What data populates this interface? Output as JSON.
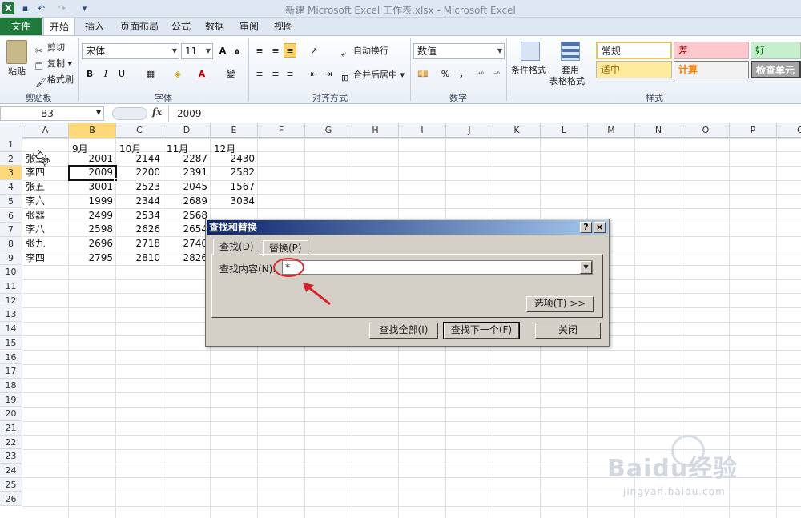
{
  "window": {
    "title": "新建 Microsoft Excel 工作表.xlsx - Microsoft Excel"
  },
  "tabs": [
    "文件",
    "开始",
    "插入",
    "页面布局",
    "公式",
    "数据",
    "审阅",
    "视图"
  ],
  "clipboard": {
    "paste": "粘贴",
    "cut": "剪切",
    "copy": "复制",
    "format_painter": "格式刷",
    "label": "剪贴板"
  },
  "font": {
    "name": "宋体",
    "size": "11",
    "bold": "B",
    "italic": "I",
    "underline": "U",
    "label": "字体",
    "grow": "A",
    "shrink": "A"
  },
  "alignment": {
    "wrap": "自动换行",
    "merge": "合并后居中",
    "label": "对齐方式"
  },
  "number": {
    "format": "数值",
    "percent": "%",
    "comma": ",",
    "label": "数字"
  },
  "styles_group": {
    "conditional": "条件格式",
    "table1": "套用",
    "table2": "表格格式",
    "label": "样式",
    "cells": [
      "常规",
      "差",
      "好",
      "适中",
      "计算",
      "检查单元格"
    ]
  },
  "formula_bar": {
    "name_box": "B3",
    "fx": "fx",
    "value": "2009"
  },
  "columns": [
    "A",
    "B",
    "C",
    "D",
    "E",
    "F",
    "G",
    "H",
    "I",
    "J",
    "K",
    "L",
    "M",
    "N",
    "O",
    "P",
    "Q"
  ],
  "rows": [
    "1",
    "2",
    "3",
    "4",
    "5",
    "6",
    "7",
    "8",
    "9",
    "10",
    "11",
    "12",
    "13",
    "14",
    "15",
    "16",
    "17",
    "18",
    "19",
    "20",
    "21",
    "22",
    "23",
    "24",
    "25",
    "26"
  ],
  "sheet": {
    "a1_rotated": "工资",
    "months": [
      "9月",
      "10月",
      "11月",
      "12月"
    ],
    "names": [
      "张三",
      "李四",
      "张五",
      "李六",
      "张器",
      "李八",
      "张九",
      "李四"
    ],
    "values": [
      [
        "2001",
        "2144",
        "2287",
        "2430"
      ],
      [
        "2009",
        "2200",
        "2391",
        "2582"
      ],
      [
        "3001",
        "2523",
        "2045",
        "1567"
      ],
      [
        "1999",
        "2344",
        "2689",
        "3034"
      ],
      [
        "2499",
        "2534",
        "2568",
        ""
      ],
      [
        "2598",
        "2626",
        "2654",
        ""
      ],
      [
        "2696",
        "2718",
        "2740",
        ""
      ],
      [
        "2795",
        "2810",
        "2826",
        ""
      ]
    ]
  },
  "dialog": {
    "title": "查找和替换",
    "help": "?",
    "close_x": "×",
    "tab_find": "查找(D)",
    "tab_replace": "替换(P)",
    "find_label": "查找内容(N):",
    "find_value": "*",
    "options": "选项(T) >>",
    "find_all": "查找全部(I)",
    "find_next": "查找下一个(F)",
    "close": "关闭"
  },
  "watermark": {
    "brand": "Baidu经验",
    "url": "jingyan.baidu.com"
  }
}
